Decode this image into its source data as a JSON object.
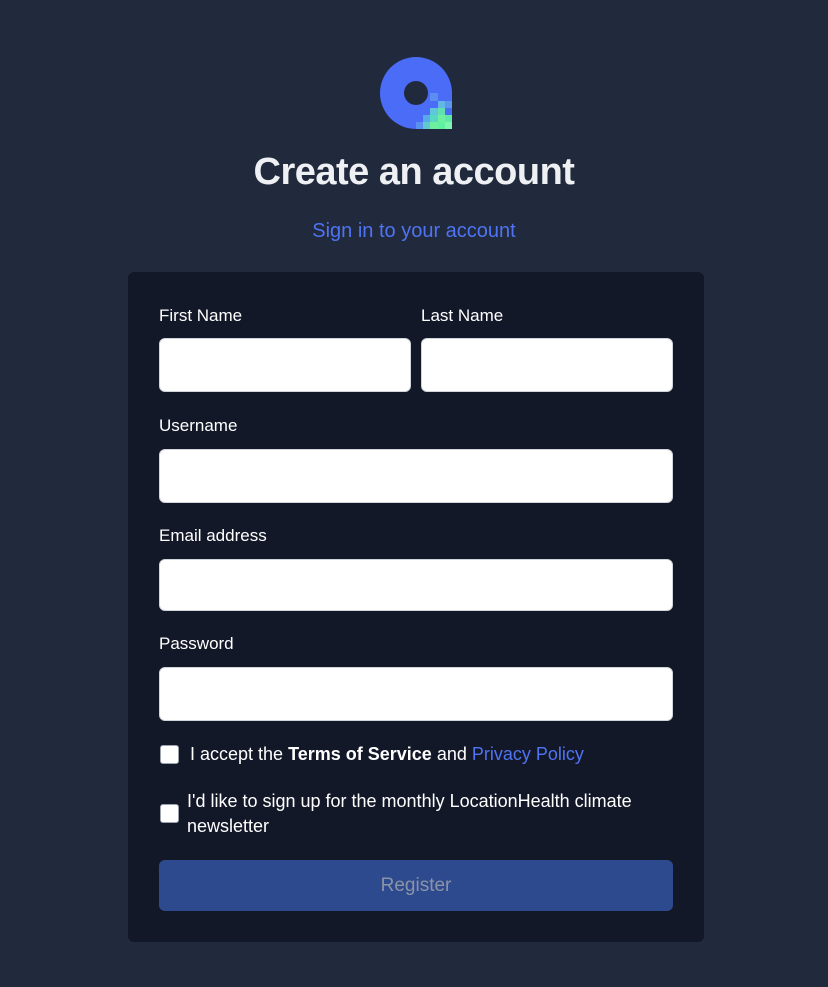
{
  "header": {
    "title": "Create an account",
    "signin_link": "Sign in to your account"
  },
  "form": {
    "first_name": {
      "label": "First Name",
      "value": ""
    },
    "last_name": {
      "label": "Last Name",
      "value": ""
    },
    "username": {
      "label": "Username",
      "value": ""
    },
    "email": {
      "label": "Email address",
      "value": ""
    },
    "password": {
      "label": "Password",
      "value": ""
    },
    "terms": {
      "checked": false,
      "prefix": "I accept the ",
      "terms_link": "Terms of Service",
      "middle": " and ",
      "privacy_link": "Privacy Policy"
    },
    "newsletter": {
      "checked": false,
      "line1": "I'd like to sign up for the monthly LocationHealth climate",
      "line2": "newsletter"
    },
    "register_label": "Register"
  },
  "colors": {
    "background": "#202a3c",
    "card": "#131829",
    "accent": "#4f73f2",
    "button": "#2e4a8f",
    "logo_blue": "#4a6cf7",
    "logo_green": "#5ff0a0"
  },
  "icons": {
    "logo": "location-pin-logo-icon"
  }
}
